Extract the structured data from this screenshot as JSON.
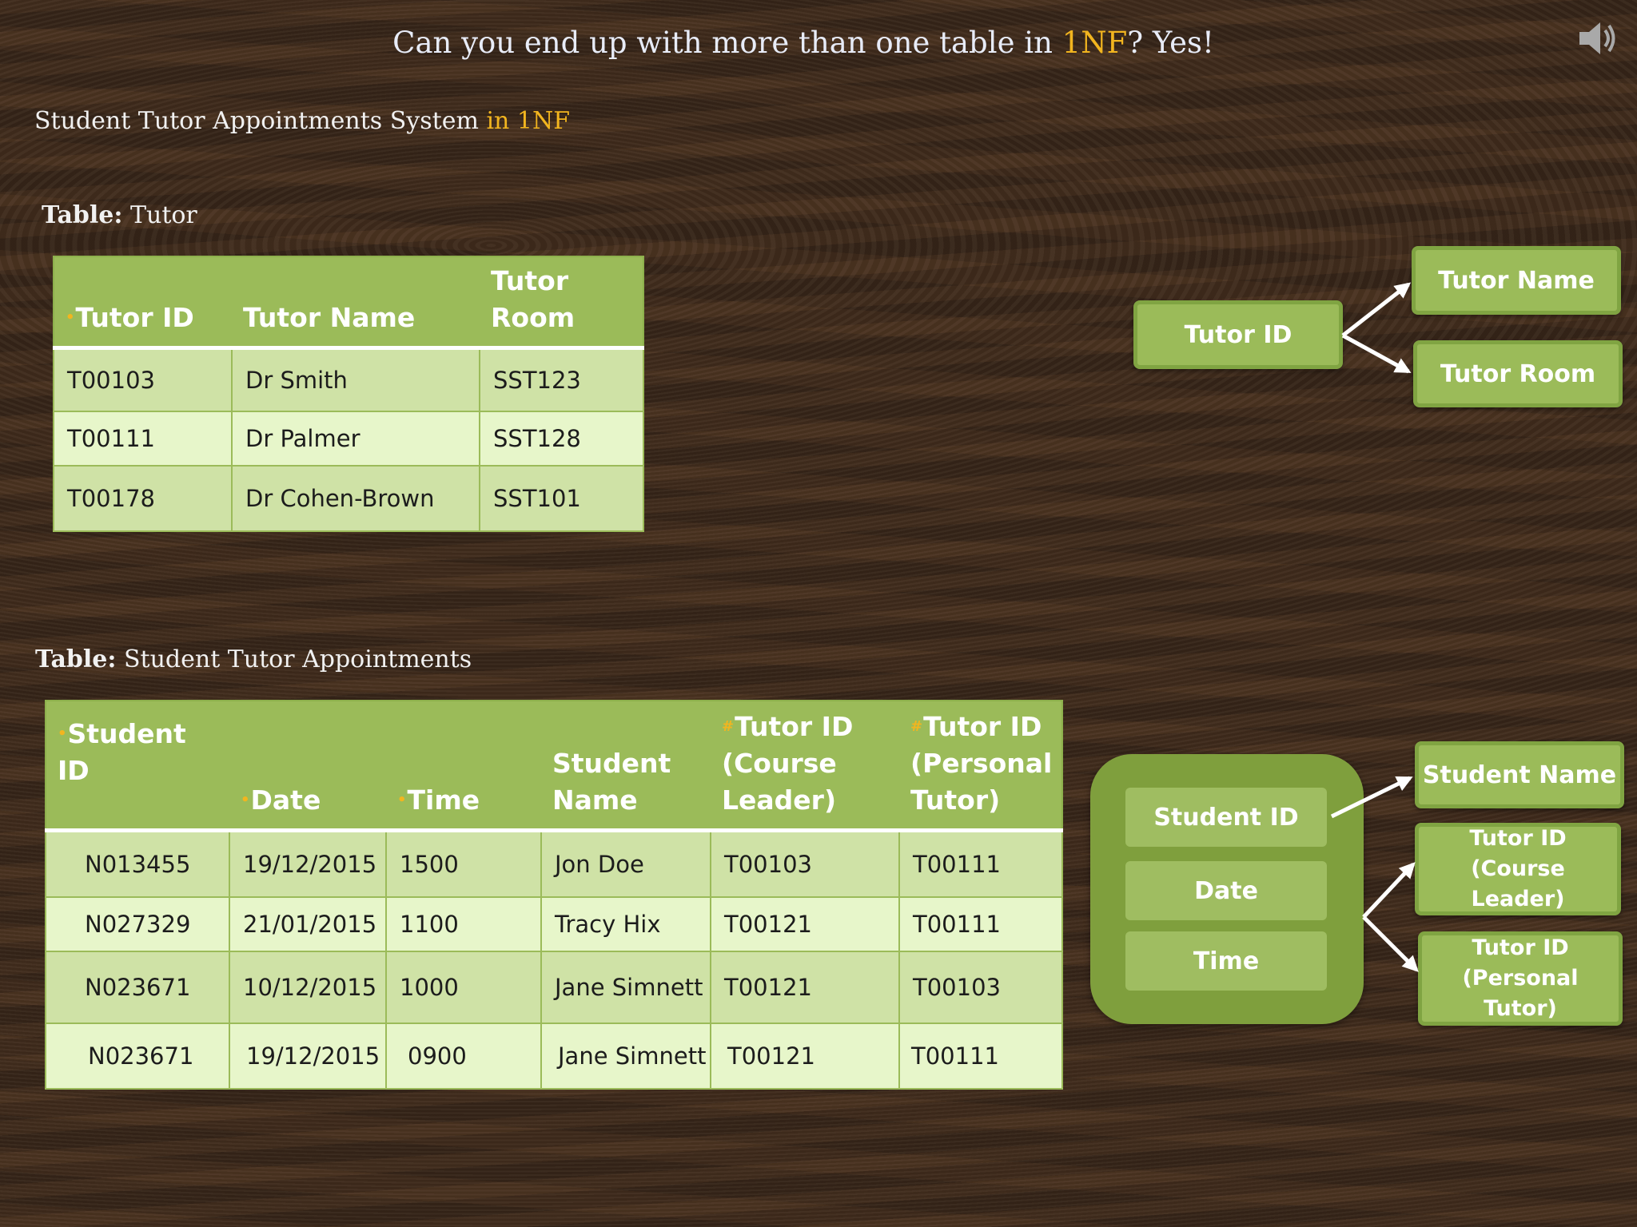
{
  "title": {
    "part1": "Can you end up with more than one table in ",
    "highlight": "1NF",
    "part2": "? Yes!"
  },
  "subtitle": {
    "text": "Student Tutor Appointments  System ",
    "highlight": "in 1NF"
  },
  "tutor_table": {
    "caption_label": "Table:",
    "caption_name": "Tutor",
    "headers": [
      "Tutor ID",
      "Tutor Name",
      "Tutor Room"
    ],
    "rows": [
      [
        "T00103",
        "Dr Smith",
        "SST123"
      ],
      [
        "T00111",
        "Dr Palmer",
        "SST128"
      ],
      [
        "T00178",
        "Dr Cohen-Brown",
        "SST101"
      ]
    ]
  },
  "appointments_table": {
    "caption_label": "Table:",
    "caption_name": "Student Tutor Appointments",
    "headers": [
      "Student ID",
      "Date",
      "Time",
      "Student Name",
      "Tutor ID (Course Leader)",
      "Tutor ID (Personal Tutor)"
    ],
    "rows": [
      [
        "N013455",
        "19/12/2015",
        "1500",
        "Jon Doe",
        "T00103",
        "T00111"
      ],
      [
        "N027329",
        "21/01/2015",
        "1100",
        "Tracy Hix",
        "T00121",
        "T00111"
      ],
      [
        "N023671",
        "10/12/2015",
        "1000",
        "Jane Simnett",
        "T00121",
        "T00103"
      ],
      [
        "N023671",
        "19/12/2015",
        "0900",
        "Jane Simnett",
        "T00121",
        "T00111"
      ]
    ]
  },
  "dependency_tutor": {
    "determinant": "Tutor ID",
    "dependents": [
      "Tutor Name",
      "Tutor Room"
    ]
  },
  "dependency_appointments": {
    "key_parts": [
      "Student ID",
      "Date",
      "Time"
    ],
    "dependents": [
      "Student Name",
      "Tutor ID (Course Leader)",
      "Tutor ID (Personal Tutor)"
    ]
  },
  "colors": {
    "accent": "#f2b51f",
    "header_green": "#9bbb59",
    "row_odd": "#cfe2a6",
    "row_even": "#e7f6ca",
    "box_dark": "#7f9f3d"
  },
  "icons": {
    "speaker": "speaker-icon"
  }
}
